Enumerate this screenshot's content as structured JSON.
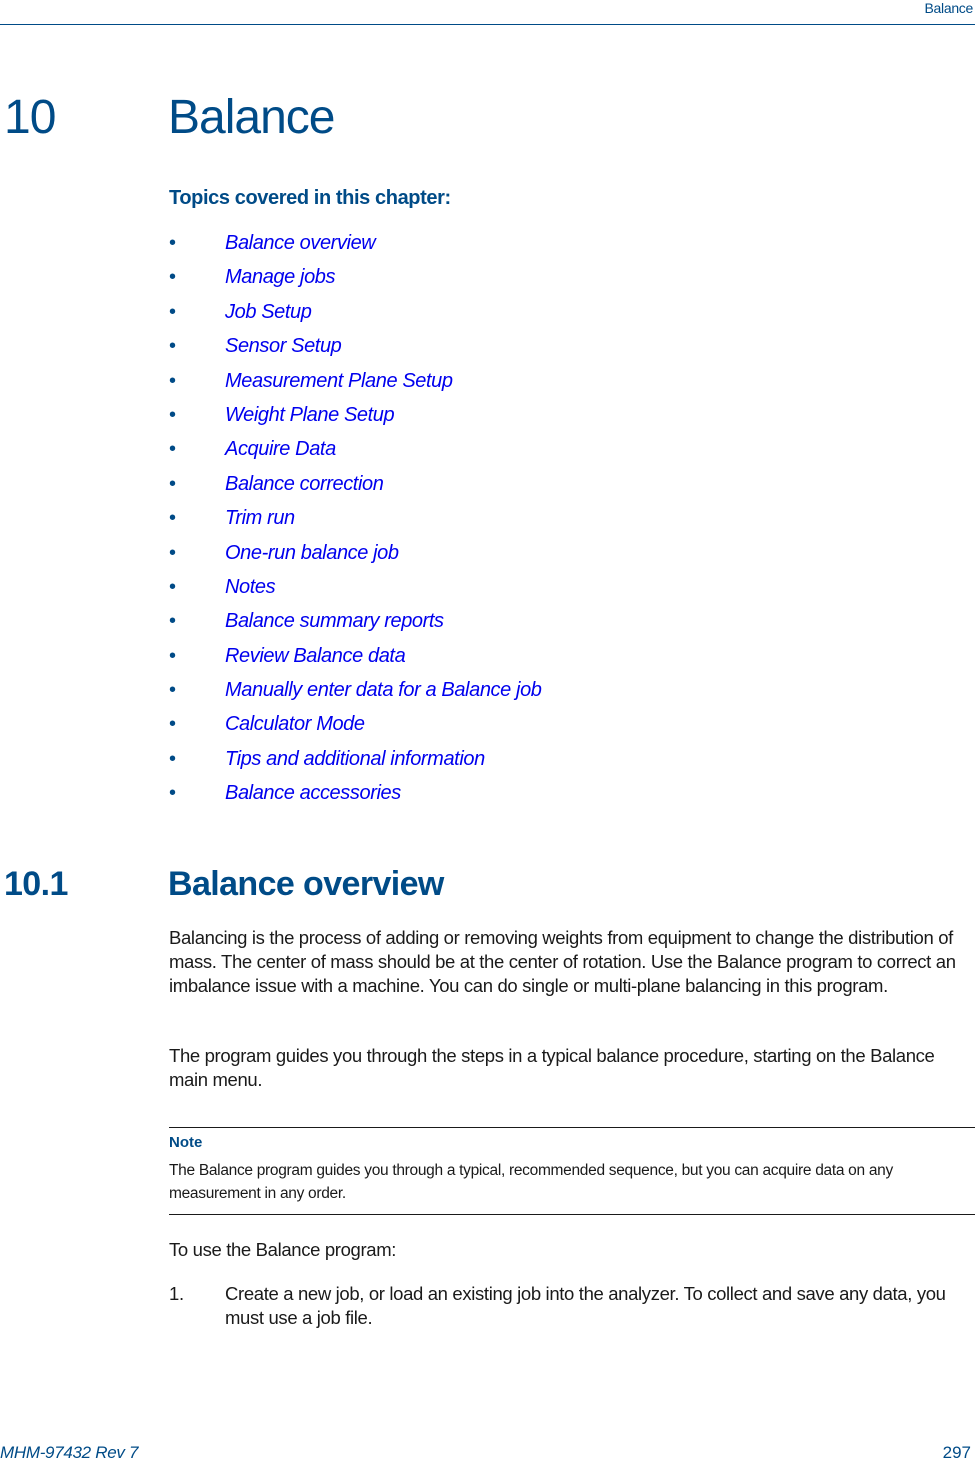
{
  "header": {
    "running_title": "Balance"
  },
  "chapter": {
    "number": "10",
    "title": "Balance"
  },
  "topics": {
    "heading": "Topics covered in this chapter:",
    "bullet": "•",
    "items": [
      "Balance overview",
      "Manage jobs",
      "Job Setup",
      "Sensor Setup",
      "Measurement Plane Setup",
      "Weight Plane Setup",
      "Acquire Data",
      "Balance correction",
      "Trim run",
      "One-run balance job",
      "Notes",
      "Balance summary reports",
      "Review Balance data",
      "Manually enter data for a Balance job",
      "Calculator Mode",
      "Tips and additional information",
      "Balance accessories"
    ]
  },
  "section": {
    "number": "10.1",
    "title": "Balance overview",
    "paragraphs": [
      "Balancing is the process of adding or removing weights from equipment to change the distribution of mass. The center of mass should be at the center of rotation. Use the Balance program to correct an imbalance issue with a machine. You can do single or multi-plane balancing in this program.",
      "The program guides you through the steps in a typical balance procedure, starting on the Balance main menu.",
      "To use the Balance program:"
    ],
    "note": {
      "label": "Note",
      "text": "The Balance program guides you through a typical, recommended sequence, but you can acquire data on any measurement in any order."
    },
    "steps": [
      {
        "number": "1.",
        "text": "Create a new job, or load an existing job into the analyzer. To collect and save any data, you must use a job file."
      }
    ]
  },
  "footer": {
    "doc_id": "MHM-97432 Rev 7",
    "page_number": "297"
  },
  "colors": {
    "brand_blue": "#004b87",
    "link_blue": "#0000ee",
    "text": "#1a1a1a"
  }
}
